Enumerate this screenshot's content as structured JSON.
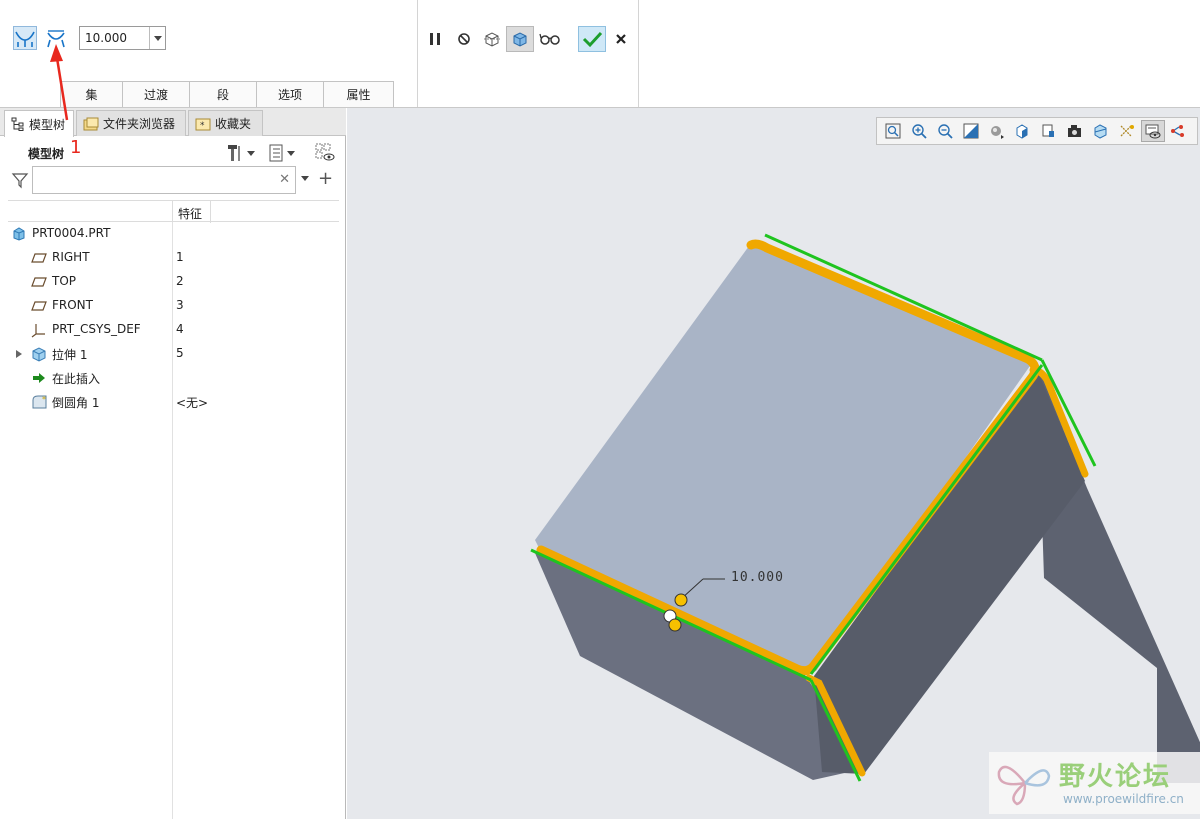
{
  "ribbon": {
    "dimension_value": "10.000",
    "subtabs": [
      "集",
      "过渡",
      "段",
      "选项",
      "属性"
    ]
  },
  "annotation": {
    "callout_number": "1"
  },
  "panel": {
    "tabs": [
      "模型树",
      "文件夹浏览器",
      "收藏夹"
    ],
    "tree_title": "模型树",
    "filter_placeholder": "",
    "column_header": "特征",
    "rows": [
      {
        "label": "PRT0004.PRT",
        "feature": ""
      },
      {
        "label": "RIGHT",
        "feature": "1"
      },
      {
        "label": "TOP",
        "feature": "2"
      },
      {
        "label": "FRONT",
        "feature": "3"
      },
      {
        "label": "PRT_CSYS_DEF",
        "feature": "4"
      },
      {
        "label": "拉伸 1",
        "feature": "5"
      },
      {
        "label": "在此插入",
        "feature": ""
      },
      {
        "label": "倒圆角 1",
        "feature": "<无>"
      }
    ]
  },
  "viewport": {
    "dimension_label": "10.000"
  },
  "watermark": {
    "title": "野火论坛",
    "url": "www.proewildfire.cn"
  },
  "colors": {
    "highlight_edge": "#f0a800",
    "selected_edge": "#1fc41f",
    "top_face": "#a9b4c6",
    "annotation_arrow": "#e8281e"
  }
}
